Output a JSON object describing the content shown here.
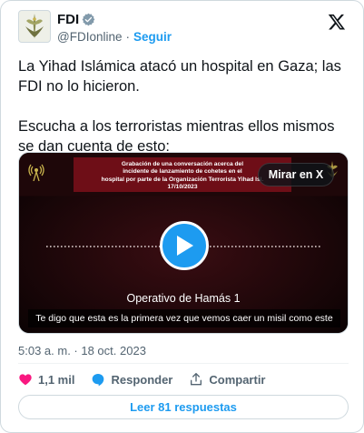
{
  "author": {
    "name": "FDI",
    "handle": "@FDIonline",
    "separator": "·",
    "follow_label": "Seguir",
    "verified": true
  },
  "tweet": {
    "paragraphs": [
      "La Yihad Islámica atacó un hospital en Gaza; las FDI no lo hicieron.",
      "Escucha a los terroristas mientras ellos mismos se dan cuenta de esto:"
    ]
  },
  "media": {
    "banner_lines": [
      "Grabación de una conversación acerca del",
      "incidente de lanzamiento de cohetes en el",
      "hospital por parte de la Organización Terrorista Yihad Isl.",
      "17/10/2023"
    ],
    "watch_on_x_label": "Mirar en X",
    "speaker_label": "Operativo de Hamás 1",
    "subtitle": "Te digo que esta es la primera vez que vemos caer un misil como este"
  },
  "meta": {
    "timestamp": "5:03 a. m. · 18 oct. 2023"
  },
  "actions": {
    "likes": "1,1 mil",
    "reply_label": "Responder",
    "share_label": "Compartir"
  },
  "replies_button": "Leer 81 respuestas",
  "colors": {
    "accent": "#1d9bf0",
    "like": "#f91880",
    "banner": "#6e0e17",
    "media_bg": "#160607"
  }
}
